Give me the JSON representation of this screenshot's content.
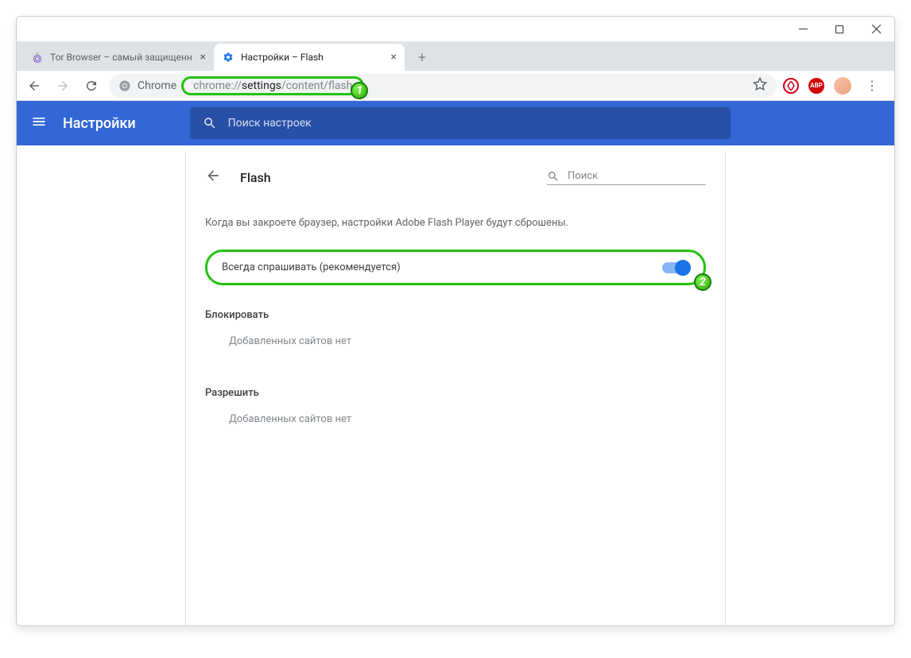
{
  "tabs": [
    {
      "title": "Tor Browser – самый защищенн",
      "active": false,
      "favicon": "onion"
    },
    {
      "title": "Настройки – Flash",
      "active": true,
      "favicon": "gear"
    }
  ],
  "omnibox": {
    "chrome_label": "Chrome",
    "url_prefix": "chrome://",
    "url_main": "settings",
    "url_suffix": "/content/flash"
  },
  "header": {
    "title": "Настройки",
    "search_placeholder": "Поиск настроек"
  },
  "panel": {
    "title": "Flash",
    "search_placeholder": "Поиск",
    "info": "Когда вы закроете браузер, настройки Adobe Flash Player будут сброшены.",
    "toggle_label": "Всегда спрашивать (рекомендуется)",
    "block_heading": "Блокировать",
    "block_empty": "Добавленных сайтов нет",
    "allow_heading": "Разрешить",
    "allow_empty": "Добавленных сайтов нет"
  },
  "badges": {
    "one": "1",
    "two": "2"
  },
  "icons": {
    "abp": "ABP"
  }
}
